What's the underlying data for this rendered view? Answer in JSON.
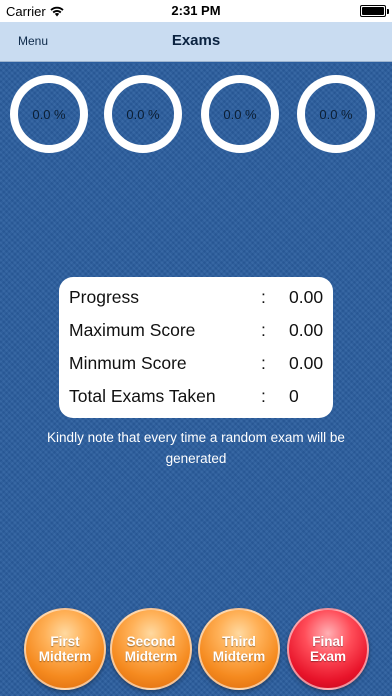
{
  "status_bar": {
    "carrier": "Carrier",
    "time": "2:31 PM"
  },
  "nav": {
    "menu_label": "Menu",
    "title": "Exams"
  },
  "progress_rings": [
    {
      "name": "first-midterm",
      "value": "0.0 %"
    },
    {
      "name": "second-midterm",
      "value": "0.0 %"
    },
    {
      "name": "third-midterm",
      "value": "0.0 %"
    },
    {
      "name": "final-exam",
      "value": "0.0 %"
    }
  ],
  "stats": [
    {
      "label": "Progress",
      "separator": ":",
      "value": "0.00"
    },
    {
      "label": "Maximum Score",
      "separator": ":",
      "value": "0.00"
    },
    {
      "label": "Minmum Score",
      "separator": ":",
      "value": "0.00"
    },
    {
      "label": "Total Exams Taken",
      "separator": ":",
      "value": "0"
    }
  ],
  "note": "Kindly note that every time a random exam will be generated",
  "exam_buttons": [
    {
      "label": "First Midterm",
      "color": "#f58a1f"
    },
    {
      "label": "Second Midterm",
      "color": "#f58a1f"
    },
    {
      "label": "Third Midterm",
      "color": "#f58a1f"
    },
    {
      "label": "Final Exam",
      "color": "#e8142a"
    }
  ],
  "colors": {
    "background": "#2a5d9e",
    "navbar": "#c9dcf1",
    "card": "#ffffff"
  }
}
